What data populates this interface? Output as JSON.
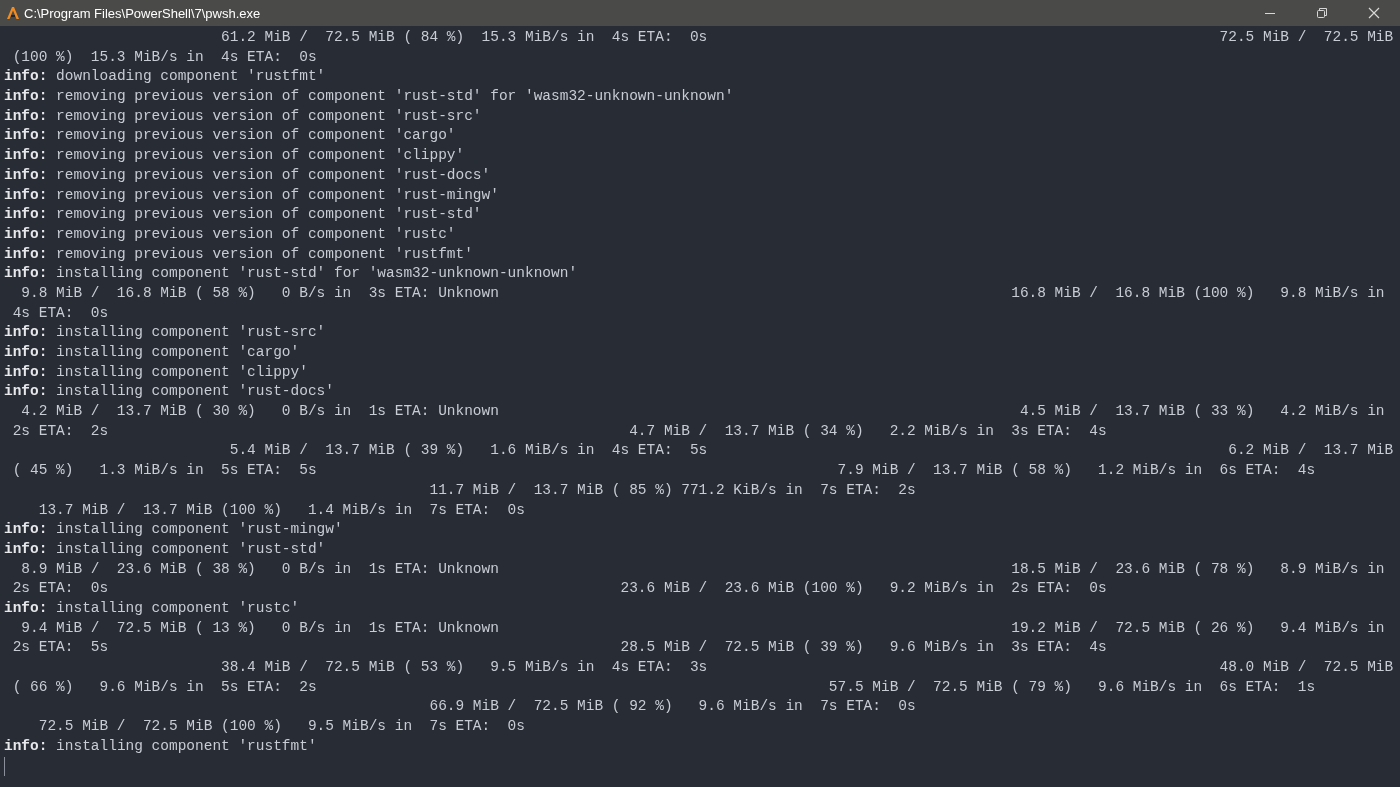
{
  "window": {
    "title": "C:\\Program Files\\PowerShell\\7\\pwsh.exe"
  },
  "terminal": {
    "lines": [
      {
        "kind": "output",
        "segments": [
          "                         61.2 MiB /  72.5 MiB ( 84 %)  15.3 MiB/s in  4s ETA:  0s",
          "                                                           72.5 MiB /  72.5 MiB"
        ]
      },
      {
        "kind": "output",
        "segments": [
          " (100 %)  15.3 MiB/s in  4s ETA:  0s"
        ]
      },
      {
        "kind": "info",
        "text": "**info:** downloading component 'rustfmt'"
      },
      {
        "kind": "info",
        "text": "**info:** removing previous version of component 'rust-std' for 'wasm32-unknown-unknown'"
      },
      {
        "kind": "info",
        "text": "**info:** removing previous version of component 'rust-src'"
      },
      {
        "kind": "info",
        "text": "**info:** removing previous version of component 'cargo'"
      },
      {
        "kind": "info",
        "text": "**info:** removing previous version of component 'clippy'"
      },
      {
        "kind": "info",
        "text": "**info:** removing previous version of component 'rust-docs'"
      },
      {
        "kind": "info",
        "text": "**info:** removing previous version of component 'rust-mingw'"
      },
      {
        "kind": "info",
        "text": "**info:** removing previous version of component 'rust-std'"
      },
      {
        "kind": "info",
        "text": "**info:** removing previous version of component 'rustc'"
      },
      {
        "kind": "info",
        "text": "**info:** removing previous version of component 'rustfmt'"
      },
      {
        "kind": "info",
        "text": "**info:** installing component 'rust-std' for 'wasm32-unknown-unknown'"
      },
      {
        "kind": "output",
        "segments": [
          "  9.8 MiB /  16.8 MiB ( 58 %)   0 B/s in  3s ETA: Unknown",
          "                                                           16.8 MiB /  16.8 MiB (100 %)   9.8 MiB/s in"
        ]
      },
      {
        "kind": "output",
        "segments": [
          " 4s ETA:  0s"
        ]
      },
      {
        "kind": "info",
        "text": "**info:** installing component 'rust-src'"
      },
      {
        "kind": "info",
        "text": "**info:** installing component 'cargo'"
      },
      {
        "kind": "info",
        "text": "**info:** installing component 'clippy'"
      },
      {
        "kind": "info",
        "text": "**info:** installing component 'rust-docs'"
      },
      {
        "kind": "output",
        "segments": [
          "  4.2 MiB /  13.7 MiB ( 30 %)   0 B/s in  1s ETA: Unknown",
          "                                                            4.5 MiB /  13.7 MiB ( 33 %)   4.2 MiB/s in"
        ]
      },
      {
        "kind": "output",
        "segments": [
          " 2s ETA:  2s",
          "                                                            4.7 MiB /  13.7 MiB ( 34 %)   2.2 MiB/s in  3s ETA:  4s"
        ]
      },
      {
        "kind": "output",
        "segments": [
          "                          5.4 MiB /  13.7 MiB ( 39 %)   1.6 MiB/s in  4s ETA:  5s",
          "                                                            6.2 MiB /  13.7 MiB"
        ]
      },
      {
        "kind": "output",
        "segments": [
          " ( 45 %)   1.3 MiB/s in  5s ETA:  5s",
          "                                                            7.9 MiB /  13.7 MiB ( 58 %)   1.2 MiB/s in  6s ETA:  4s"
        ]
      },
      {
        "kind": "output",
        "segments": [
          "                                                 11.7 MiB /  13.7 MiB ( 85 %) 771.2 KiB/s in  7s ETA:  2s"
        ]
      },
      {
        "kind": "output",
        "segments": [
          "    13.7 MiB /  13.7 MiB (100 %)   1.4 MiB/s in  7s ETA:  0s"
        ]
      },
      {
        "kind": "info",
        "text": "**info:** installing component 'rust-mingw'"
      },
      {
        "kind": "info",
        "text": "**info:** installing component 'rust-std'"
      },
      {
        "kind": "output",
        "segments": [
          "  8.9 MiB /  23.6 MiB ( 38 %)   0 B/s in  1s ETA: Unknown",
          "                                                           18.5 MiB /  23.6 MiB ( 78 %)   8.9 MiB/s in"
        ]
      },
      {
        "kind": "output",
        "segments": [
          " 2s ETA:  0s",
          "                                                           23.6 MiB /  23.6 MiB (100 %)   9.2 MiB/s in  2s ETA:  0s"
        ]
      },
      {
        "kind": "info",
        "text": "**info:** installing component 'rustc'"
      },
      {
        "kind": "output",
        "segments": [
          "  9.4 MiB /  72.5 MiB ( 13 %)   0 B/s in  1s ETA: Unknown",
          "                                                           19.2 MiB /  72.5 MiB ( 26 %)   9.4 MiB/s in"
        ]
      },
      {
        "kind": "output",
        "segments": [
          " 2s ETA:  5s",
          "                                                           28.5 MiB /  72.5 MiB ( 39 %)   9.6 MiB/s in  3s ETA:  4s"
        ]
      },
      {
        "kind": "output",
        "segments": [
          "                         38.4 MiB /  72.5 MiB ( 53 %)   9.5 MiB/s in  4s ETA:  3s",
          "                                                           48.0 MiB /  72.5 MiB"
        ]
      },
      {
        "kind": "output",
        "segments": [
          " ( 66 %)   9.6 MiB/s in  5s ETA:  2s",
          "                                                           57.5 MiB /  72.5 MiB ( 79 %)   9.6 MiB/s in  6s ETA:  1s"
        ]
      },
      {
        "kind": "output",
        "segments": [
          "                                                 66.9 MiB /  72.5 MiB ( 92 %)   9.6 MiB/s in  7s ETA:  0s"
        ]
      },
      {
        "kind": "output",
        "segments": [
          "    72.5 MiB /  72.5 MiB (100 %)   9.5 MiB/s in  7s ETA:  0s"
        ]
      },
      {
        "kind": "info",
        "text": "**info:** installing component 'rustfmt'"
      }
    ]
  }
}
